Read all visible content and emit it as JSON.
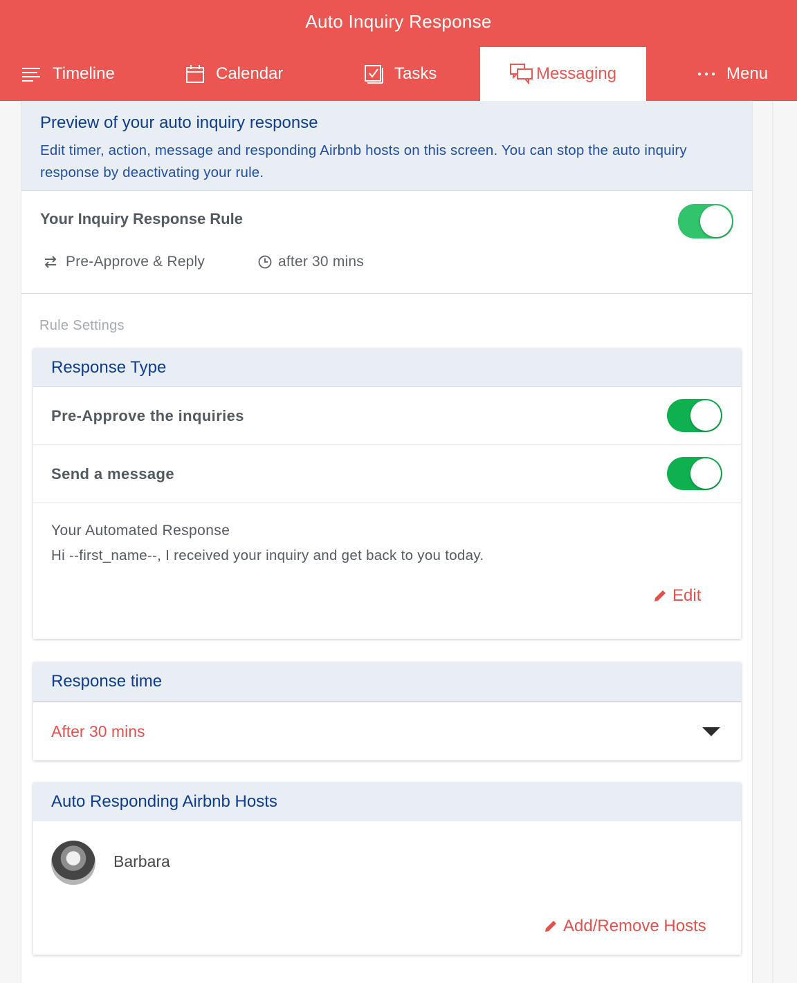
{
  "header": {
    "title": "Auto Inquiry Response",
    "nav": [
      {
        "label": "Timeline",
        "icon": "timeline-icon"
      },
      {
        "label": "Calendar",
        "icon": "calendar-icon"
      },
      {
        "label": "Tasks",
        "icon": "tasks-icon"
      },
      {
        "label": "Messaging",
        "icon": "messaging-icon",
        "active": true
      },
      {
        "label": "Menu",
        "icon": "more-dots-icon"
      }
    ]
  },
  "preview": {
    "title": "Preview of your auto inquiry response",
    "description": "Edit timer, action, message and responding Airbnb hosts on this screen. You can stop the auto inquiry response by deactivating your rule."
  },
  "rule": {
    "title": "Your Inquiry Response Rule",
    "enabled": true,
    "action": "Pre-Approve & Reply",
    "timer": "after 30 mins"
  },
  "settings": {
    "label": "Rule Settings",
    "response_type": {
      "title": "Response Type",
      "pre_approve_label": "Pre-Approve the inquiries",
      "pre_approve_on": true,
      "send_message_label": "Send a message",
      "send_message_on": true,
      "automated_label": "Your Automated Response",
      "automated_text": "Hi --first_name--, I received your inquiry and get back to you today.",
      "edit_label": "Edit"
    },
    "response_time": {
      "title": "Response time",
      "selected": "After 30 mins"
    },
    "hosts": {
      "title": "Auto Responding Airbnb Hosts",
      "items": [
        {
          "name": "Barbara"
        }
      ],
      "add_remove_label": "Add/Remove Hosts"
    }
  },
  "colors": {
    "brand_red": "#eb5652",
    "heading_blue": "#0f3c91",
    "toggle_green": "#0fb050"
  }
}
